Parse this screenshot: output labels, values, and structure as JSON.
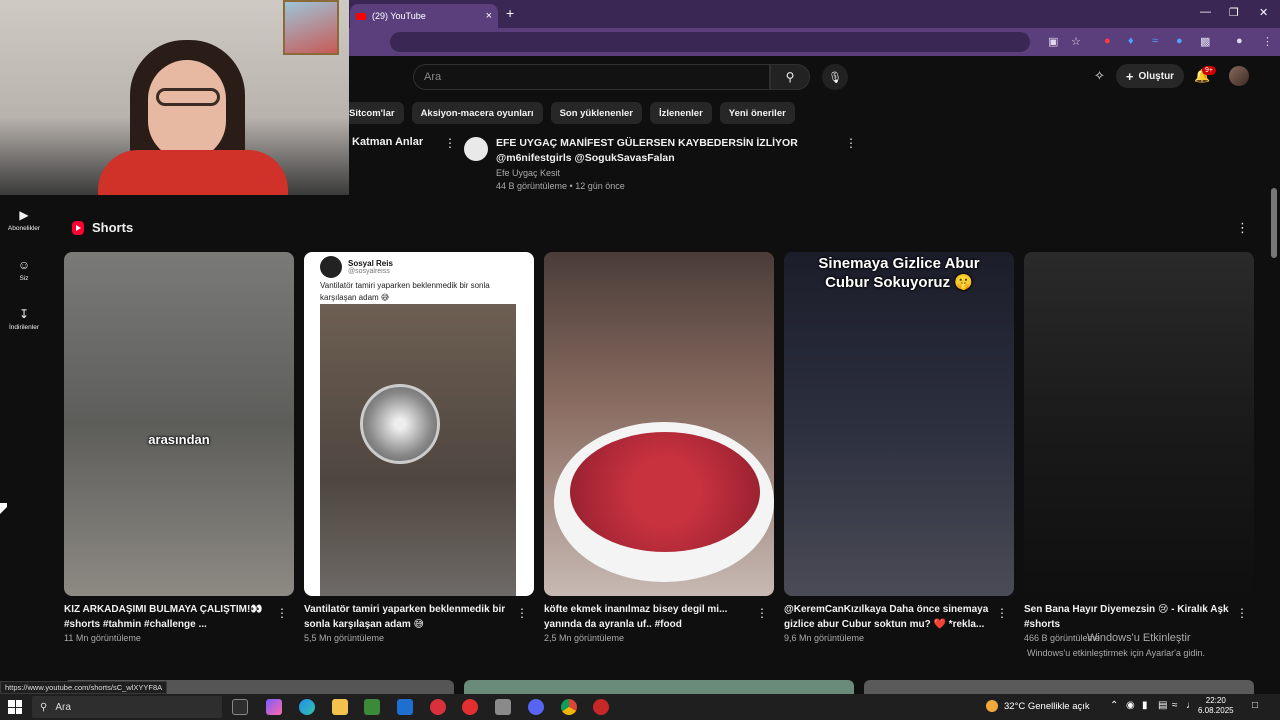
{
  "browser": {
    "tab_title": "(29) YouTube",
    "new_tab": "+",
    "close_tab": "×"
  },
  "header": {
    "search_placeholder": "Ara",
    "create_label": "Oluştur",
    "notification_count": "9+"
  },
  "chips": [
    "Sitcom'lar",
    "Aksiyon-macera oyunları",
    "Son yüklenenler",
    "İzlenenler",
    "Yeni öneriler"
  ],
  "sidebar": [
    {
      "label": "Abonelikler",
      "icon": "subscriptions-icon"
    },
    {
      "label": "Siz",
      "icon": "you-icon"
    },
    {
      "label": "İndirilenler",
      "icon": "download-icon"
    }
  ],
  "previous_row": {
    "left_title": "Katman Anlar",
    "video_title": "EFE UYGAÇ MANİFEST GÜLERSEN KAYBEDERSİN İZLİYOR @m6nifestgirls @SogukSavasFalan",
    "channel": "Efe Uygaç Kesit",
    "meta": "44 B görüntüleme • 12 gün önce"
  },
  "shorts": {
    "heading": "Shorts",
    "items": [
      {
        "title": "KIZ ARKADAŞIMI BULMAYA ÇALIŞTIM!👀 #shorts #tahmin #challenge ...",
        "views": "11 Mn görüntüleme",
        "overlay": "arasından"
      },
      {
        "title": "Vantilatör tamiri yaparken beklenmedik bir sonla karşılaşan adam 😅",
        "views": "5,5 Mn görüntüleme",
        "tweet_name": "Sosyal Reis",
        "tweet_handle": "@sosyalreiss",
        "tweet_text": "Vantilatör tamiri yaparken beklenmedik bir sonla karşılaşan adam 😅"
      },
      {
        "title": "köfte ekmek inanılmaz bisey degil mi... yanında da ayranla uf.. #food",
        "views": "2,5 Mn görüntüleme"
      },
      {
        "title": "@KeremCanKızılkaya Daha önce sinemaya gizlice abur Cubur soktun mu? ❤️ *rekla...",
        "views": "9,6 Mn görüntüleme",
        "overlay": "Sinemaya Gizlice Abur Cubur Sokuyoruz 🤫"
      },
      {
        "title": "Sen Bana Hayır Diyemezsin 😢 - Kiralık Aşk #shorts",
        "views": "466 B görüntüleme"
      }
    ]
  },
  "activation": {
    "title": "Windows'u Etkinleştir",
    "subtitle": "Windows'u etkinleştirmek için Ayarlar'a gidin."
  },
  "status_url": "https://www.youtube.com/shorts/sC_wlXYYF8A",
  "taskbar": {
    "search_placeholder": "Ara",
    "weather": "32°C  Genellikle açık",
    "time": "22:20",
    "date": "6.08.2025"
  }
}
